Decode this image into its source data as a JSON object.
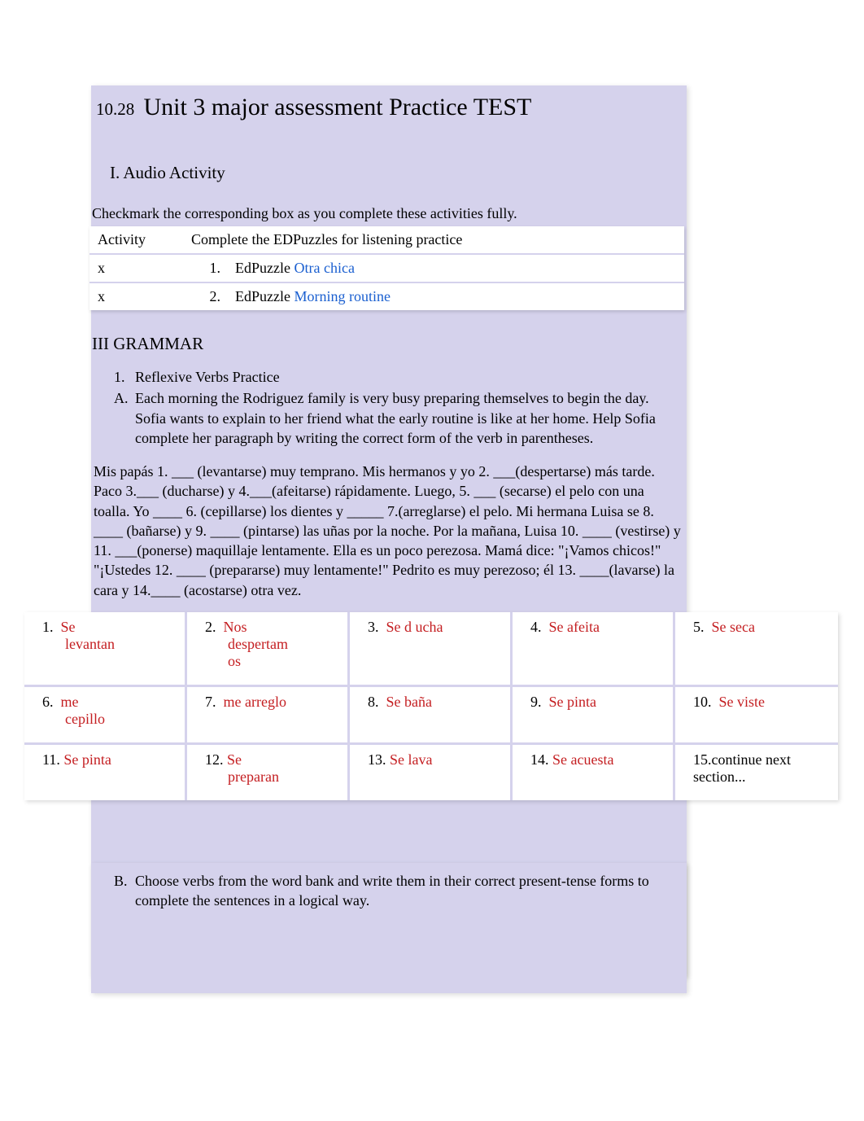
{
  "title": {
    "date": "10.28",
    "text": "Unit 3 major assessment Practice TEST"
  },
  "section1": {
    "heading": "I.    Audio Activity",
    "instruction": "Checkmark the corresponding box as you complete these activities fully.",
    "table": {
      "header_col1": "Activity",
      "header_col2": "Complete the EDPuzzles for listening practice",
      "rows": [
        {
          "col1": "x",
          "num": "1.",
          "prefix": "EdPuzzle   ",
          "link": "Otra chica"
        },
        {
          "col1": "x",
          "num": "2.",
          "prefix": "EdPuzzle   ",
          "link": "Morning routine"
        }
      ]
    }
  },
  "grammar": {
    "heading": "III GRAMMAR",
    "item1_num": "1.",
    "item1_text": "Reflexive Verbs Practice",
    "itemA_num": "A.",
    "itemA_text": "Each morning the Rodriguez family is very busy preparing themselves to begin the day. Sofia wants to explain to her friend what the early routine is like at her home. Help Sofia complete her paragraph by writing the correct form of the verb in parentheses.",
    "paragraph": "Mis papás   1. ___ (levantarse) muy temprano. Mis hermanos y yo          2.  ___(despertarse) más tarde. Paco 3.___ (ducharse) y 4.___(afeitarse) rápidamente.             Luego,    5. ___ (secarse) el pelo con una toalla. Yo ____ 6. (cepillarse) los dientes y _____  7.(arreglarse) el pelo. Mi hermana Luisa se 8. ____ (bañarse) y       9. ____ (pintarse) las uñas por la noche.        Por la mañana, Luisa 10. ____ (vestirse) y 11. ___(ponerse) maquillaje lentamente. Ella es un poco perezosa.               Mamá dice: \"¡Vamos chicos!\" \"¡Ustedes     12. ____ (prepararse) muy lentamente!\" Pedrito es muy perezoso; él    13. ____(lavarse) la cara y      14.____ (acostarse) otra vez.",
    "answers": [
      {
        "num": "1.",
        "ans": "Se levantan",
        "wrap": true
      },
      {
        "num": "2.",
        "ans": "Nos despertamos",
        "wrap": true
      },
      {
        "num": "3.",
        "ans": "Se d   ucha"
      },
      {
        "num": "4.",
        "ans": "Se   afeita"
      },
      {
        "num": "5.",
        "ans": "Se   seca"
      },
      {
        "num": "6.",
        "ans": "me cepillo",
        "wrap": true
      },
      {
        "num": "7.",
        "ans": "me arreglo"
      },
      {
        "num": "8.",
        "ans": "Se   baña"
      },
      {
        "num": "9.",
        "ans": "Se   pinta"
      },
      {
        "num": "10.",
        "ans": "Se   viste"
      },
      {
        "num": "11.",
        "ans": "Se   pinta"
      },
      {
        "num": "12.",
        "ans": "Se preparan",
        "wrap": true
      },
      {
        "num": "13.",
        "ans": "Se   lava"
      },
      {
        "num": "14.",
        "ans": "Se   acuesta"
      },
      {
        "num": "15.",
        "cont": "continue next section..."
      }
    ],
    "itemB_num": "B.",
    "itemB_text": "Choose verbs from the word bank and write them in their correct present-tense forms to complete the sentences in a logical way."
  }
}
